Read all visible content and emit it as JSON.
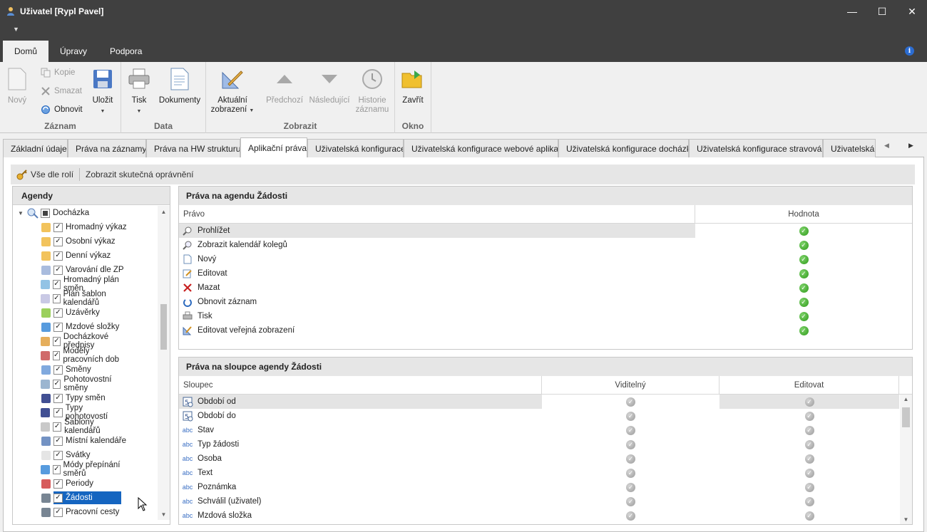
{
  "window": {
    "title": "Uživatel [Rypl Pavel]"
  },
  "ribbon_tabs": [
    "Domů",
    "Úpravy",
    "Podpora"
  ],
  "ribbon": {
    "groups": {
      "zaznam": "Záznam",
      "data": "Data",
      "zobrazit": "Zobrazit",
      "okno": "Okno"
    },
    "novy": "Nový",
    "kopie": "Kopie",
    "smazat": "Smazat",
    "obnovit": "Obnovit",
    "ulozit": "Uložit",
    "tisk": "Tisk",
    "dokumenty": "Dokumenty",
    "aktualni_1": "Aktuální",
    "aktualni_2": "zobrazení",
    "predchozi": "Předchozí",
    "nasledujici": "Následující",
    "historie_1": "Historie",
    "historie_2": "záznamu",
    "zavrit": "Zavřít"
  },
  "page_tabs": [
    "Základní údaje",
    "Práva na záznamy",
    "Práva na HW strukturu",
    "Aplikační práva",
    "Uživatelská konfigurace",
    "Uživatelská konfigurace webové aplikace",
    "Uživatelská konfigurace docházky",
    "Uživatelská konfigurace stravování",
    "Uživatelská k"
  ],
  "subtoolbar": {
    "vse_dle_roli": "Vše dle rolí",
    "zobrazit_skutecna": "Zobrazit skutečná oprávnění"
  },
  "agenda": {
    "header": "Agendy",
    "root": "Docházka",
    "items": [
      "Hromadný výkaz",
      "Osobní výkaz",
      "Denní výkaz",
      "Varování dle ZP",
      "Hromadný plán směn",
      "Plán šablon kalendářů",
      "Uzávěrky",
      "Mzdové složky",
      "Docházkové předpisy",
      "Modely pracovních dob",
      "Směny",
      "Pohotovostní směny",
      "Typy směn",
      "Typy pohotovostí",
      "Šablony kalendářů",
      "Místní kalendáře",
      "Svátky",
      "Módy přepínání směrů",
      "Periody",
      "Žádosti",
      "Pracovní cesty"
    ],
    "selected": "Žádosti"
  },
  "rights_panel": {
    "title": "Práva na agendu Žádosti",
    "col_pravo": "Právo",
    "col_hodnota": "Hodnota",
    "rows": [
      "Prohlížet",
      "Zobrazit kalendář kolegů",
      "Nový",
      "Editovat",
      "Mazat",
      "Obnovit záznam",
      "Tisk",
      "Editovat veřejná zobrazení"
    ]
  },
  "columns_panel": {
    "title": "Práva na sloupce agendy Žádosti",
    "col_sloupec": "Sloupec",
    "col_viditelny": "Viditelný",
    "col_editovat": "Editovat",
    "rows": [
      "Období od",
      "Období do",
      "Stav",
      "Typ žádosti",
      "Osoba",
      "Text",
      "Poznámka",
      "Schválil (uživatel)",
      "Mzdová složka"
    ]
  }
}
